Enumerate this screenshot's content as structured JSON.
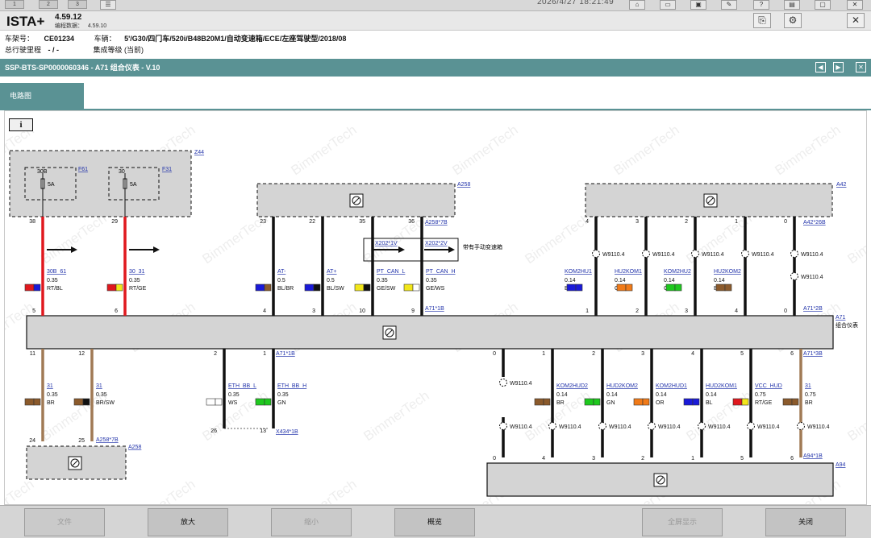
{
  "top": {
    "tabs": [
      "1",
      "2",
      "3"
    ],
    "clock": "2026/4/27 18:21:49"
  },
  "header": {
    "app": "ISTA+",
    "version": "4.59.12",
    "data_label": "编程数据：",
    "data_version": "4.59.10"
  },
  "vehicle": {
    "vin_label": "车架号：",
    "vin": "CE01234",
    "car_label": "车辆：",
    "car": "5'/G30/四门车/520i/B48B20M1/自动变速箱/ECE/左座驾驶型/2018/08",
    "mileage_label": "总行驶里程",
    "mileage": "- / -",
    "level_label": "集成等级 (当前)"
  },
  "title": "SSP-BTS-SP0000060346 - A71 组合仪表 - V.10",
  "tab": "电路图",
  "buttons": {
    "file": "文件",
    "zoom_in": "放大",
    "zoom_out": "缩小",
    "overview": "概览",
    "fullscreen": "全屏显示",
    "close": "关闭"
  },
  "colors": {
    "teal": "#5a9294",
    "red": "#e0181e",
    "brown": "#a07a55"
  },
  "diagram": {
    "z44": {
      "id": "Z44",
      "fuse1": "30B",
      "fuse1_link": "F61",
      "fuse1_amp": "5A",
      "fuse1_pin": "38",
      "fuse2": "30",
      "fuse2_link": "F31",
      "fuse2_amp": "5A",
      "fuse2_pin": "29"
    },
    "a258_top": {
      "id": "A258",
      "conn": "A258*7B"
    },
    "a42": {
      "id": "A42",
      "conn": "A42*26B"
    },
    "a71": {
      "id": "A71",
      "name": "组合仪表",
      "conn1B": "A71*1B",
      "conn2B": "A71*2B",
      "conn3B": "A71*3B"
    },
    "a258_bottom": {
      "id": "A258",
      "conn": "A258*7B"
    },
    "a94": {
      "id": "A94",
      "conn": "A94*1B"
    },
    "x434": "X434*1B",
    "x202": {
      "v1": "X202*1V",
      "v2": "X202*2V",
      "note": "带有手动变速箱"
    },
    "upper_wires": [
      {
        "signal": "30B_61",
        "cross": "0.35",
        "color": "RT/BL",
        "pin_top": "38",
        "pin_bottom": "5"
      },
      {
        "signal": "30_31",
        "cross": "0.35",
        "color": "RT/GE",
        "pin_top": "29",
        "pin_bottom": "6"
      },
      {
        "signal": "AT-",
        "cross": "0.5",
        "color": "BL/BR",
        "pin_top": "23",
        "pin_bottom": "4"
      },
      {
        "signal": "AT+",
        "cross": "0.5",
        "color": "BL/SW",
        "pin_top": "22",
        "pin_bottom": "3"
      },
      {
        "signal": "PT_CAN_L",
        "cross": "0.35",
        "color": "GE/SW",
        "pin_top": "35",
        "pin_bottom": "10"
      },
      {
        "signal": "PT_CAN_H",
        "cross": "0.35",
        "color": "GE/WS",
        "pin_top": "36",
        "pin_bottom": "9"
      },
      {
        "signal": "KOM2HU1",
        "cross": "0.14",
        "color": "BL",
        "pin_top": "4",
        "pin_bottom": "1"
      },
      {
        "signal": "HU2KOM1",
        "cross": "0.14",
        "color": "OR",
        "pin_top": "3",
        "pin_bottom": "2"
      },
      {
        "signal": "KOM2HU2",
        "cross": "0.14",
        "color": "GN",
        "pin_top": "2",
        "pin_bottom": "3"
      },
      {
        "signal": "HU2KOM2",
        "cross": "0.14",
        "color": "BR",
        "pin_top": "1",
        "pin_bottom": "4"
      },
      {
        "signal": "",
        "cross": "",
        "color": "",
        "pin_top": "0",
        "pin_bottom": "0"
      }
    ],
    "lower_wires": [
      {
        "signal": "31",
        "cross": "0.35",
        "color": "BR",
        "pin_top": "11",
        "pin_bottom": "24"
      },
      {
        "signal": "31",
        "cross": "0.35",
        "color": "BR/SW",
        "pin_top": "12",
        "pin_bottom": "25"
      },
      {
        "signal": "ETH_BB_L",
        "cross": "0.35",
        "color": "WS",
        "pin_top": "2",
        "pin_bottom": "26"
      },
      {
        "signal": "ETH_BB_H",
        "cross": "0.35",
        "color": "GN",
        "pin_top": "1",
        "pin_bottom": "13"
      },
      {
        "signal": "",
        "cross": "",
        "color": "",
        "pin_top": "0",
        "pin_bottom": "0"
      },
      {
        "signal": "KOM2HUD2",
        "cross": "0.14",
        "color": "BR",
        "pin_top": "1",
        "pin_bottom": "4"
      },
      {
        "signal": "HUD2KOM2",
        "cross": "0.14",
        "color": "GN",
        "pin_top": "2",
        "pin_bottom": "3"
      },
      {
        "signal": "KOM2HUD1",
        "cross": "0.14",
        "color": "OR",
        "pin_top": "3",
        "pin_bottom": "2"
      },
      {
        "signal": "HUD2KOM1",
        "cross": "0.14",
        "color": "BL",
        "pin_top": "4",
        "pin_bottom": "1"
      },
      {
        "signal": "VCC_HUD",
        "cross": "0.75",
        "color": "RT/GE",
        "pin_top": "5",
        "pin_bottom": "5"
      },
      {
        "signal": "31",
        "cross": "0.75",
        "color": "BR",
        "pin_top": "6",
        "pin_bottom": "6"
      }
    ],
    "splice": "W9110.4",
    "watermark": "BimmerTech"
  }
}
